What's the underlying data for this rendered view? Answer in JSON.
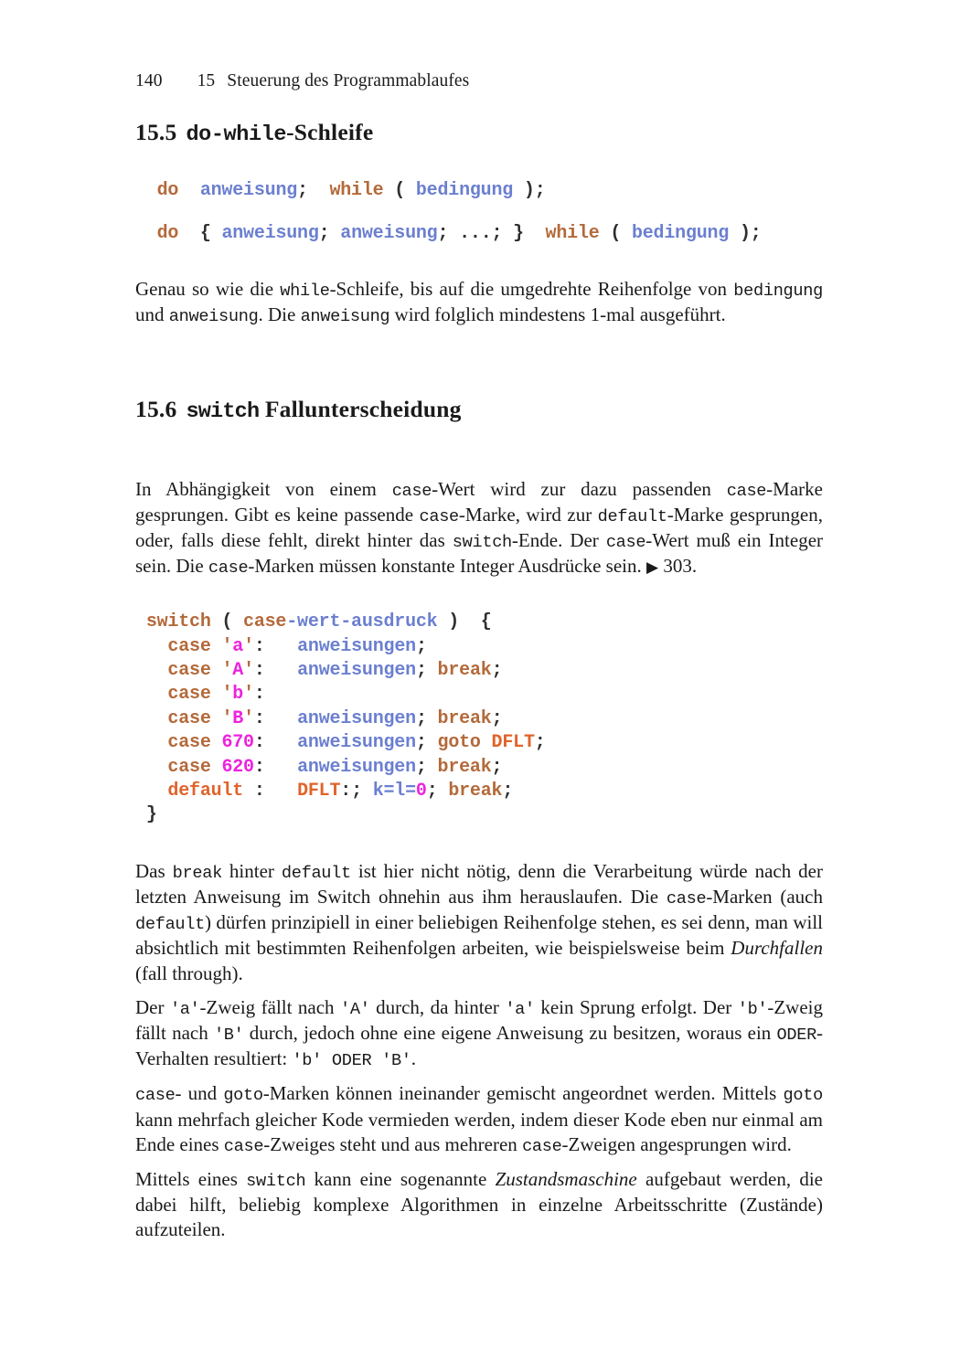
{
  "runhead": {
    "page_number": "140",
    "chapter_number": "15",
    "chapter_title": "Steuerung des Programmablaufes"
  },
  "sections": [
    {
      "number": "15.5",
      "title_mono": "do-while",
      "title_rest": "-Schleife"
    },
    {
      "number": "15.6",
      "title_mono": "switch",
      "title_rest": "Fallunterscheidung"
    }
  ],
  "code_dowhile": {
    "line1": {
      "t1": "do",
      "t2": "  ",
      "t3": "anweisung",
      "t4": ";  ",
      "t5": "while",
      "t6": " ( ",
      "t7": "bedingung",
      "t8": " );"
    },
    "line2": {
      "t1": "do",
      "t2": "  { ",
      "t3": "anweisung",
      "t4": "; ",
      "t5": "anweisung",
      "t6": "; ...; }  ",
      "t7": "while",
      "t8": " ( ",
      "t9": "bedingung",
      "t10": " );"
    }
  },
  "para_dowhile": {
    "s1": "Genau so wie die ",
    "m1": "while",
    "s2": "-Schleife, bis auf die umgedrehte Reihenfolge von ",
    "m2": "bedingung",
    "s3": " und ",
    "m3": "anweisung",
    "s4": ". Die ",
    "m4": "anweisung",
    "s5": " wird folglich mindestens 1-mal ausgeführt."
  },
  "para_switch_intro": {
    "s1": "In Abhängigkeit von einem ",
    "m1": "case",
    "s2": "-Wert wird zur dazu passenden ",
    "m2": "case",
    "s3": "-Marke gesprungen. Gibt es keine passende ",
    "m3": "case",
    "s4": "-Marke, wird zur ",
    "m4": "default",
    "s5": "-Marke gesprungen, oder, falls diese fehlt, direkt hinter das ",
    "m5": "switch",
    "s6": "-Ende. Der ",
    "m6": "case",
    "s7": "-Wert muß ein Integer sein. Die ",
    "m7": "case",
    "s8": "-Marken müssen konstante Integer Ausdrücke sein. ",
    "xref_arrow": "▶",
    "xref_page": "303."
  },
  "code_switch": {
    "l1": {
      "kw": "switch",
      "p1": " ( ",
      "kw2": "case",
      "id": "-wert-ausdruck",
      "p2": " )  {"
    },
    "l2": {
      "indent": "  ",
      "kw": "case",
      "sp": " ",
      "q1": "'",
      "lit": "a",
      "q2": "'",
      "colon": ":   ",
      "id": "anweisungen",
      "end": ";"
    },
    "l3": {
      "indent": "  ",
      "kw": "case",
      "sp": " ",
      "q1": "'",
      "lit": "A",
      "q2": "'",
      "colon": ":   ",
      "id": "anweisungen",
      "semi": "; ",
      "kw2": "break",
      "end": ";"
    },
    "l4": {
      "indent": "  ",
      "kw": "case",
      "sp": " ",
      "q1": "'",
      "lit": "b",
      "q2": "'",
      "colon": ":"
    },
    "l5": {
      "indent": "  ",
      "kw": "case",
      "sp": " ",
      "q1": "'",
      "lit": "B",
      "q2": "'",
      "colon": ":   ",
      "id": "anweisungen",
      "semi": "; ",
      "kw2": "break",
      "end": ";"
    },
    "l6": {
      "indent": "  ",
      "kw": "case",
      "sp": " ",
      "lit": "670",
      "colon": ":   ",
      "id": "anweisungen",
      "semi": "; ",
      "kw2": "goto",
      "sp2": " ",
      "lbl": "DFLT",
      "end": ";"
    },
    "l7": {
      "indent": "  ",
      "kw": "case",
      "sp": " ",
      "lit": "620",
      "colon": ":   ",
      "id": "anweisungen",
      "semi": "; ",
      "kw2": "break",
      "end": ";"
    },
    "l8": {
      "indent": "  ",
      "kw": "default",
      "colon": " :   ",
      "lbl": "DFLT",
      "semi": ":; ",
      "id": "k=l=",
      "lit": "0",
      "semi2": "; ",
      "kw2": "break",
      "end": ";"
    },
    "l9": {
      "brace": "}"
    }
  },
  "para_break": {
    "s1": "Das ",
    "m1": "break",
    "s2": " hinter ",
    "m2": "default",
    "s3": " ist hier nicht nötig, denn die Verarbeitung würde nach der letzten Anweisung im Switch ohnehin aus ihm herauslaufen. Die ",
    "m3": "case",
    "s4": "-Marken (auch ",
    "m4": "default",
    "s5": ") dürfen prinzipiell in einer beliebigen Reihenfolge stehen, es sei denn, man will absichtlich mit bestimmten Reihenfolgen arbeiten, wie beispielsweise beim ",
    "i1": "Durchfallen",
    "s6": " (fall through)."
  },
  "para_fallthrough": {
    "s1": "Der ",
    "m1": "'a'",
    "s2": "-Zweig fällt nach ",
    "m2": "'A'",
    "s3": " durch, da hinter ",
    "m3": "'a'",
    "s4": " kein Sprung erfolgt. Der ",
    "m4": "'b'",
    "s5": "-Zweig fällt nach ",
    "m5": "'B'",
    "s6": " durch, jedoch ohne eine eigene Anweisung zu besitzen, woraus ein ",
    "m6": "ODER",
    "s7": "-Verhalten resultiert: ",
    "m7": "'b' ODER 'B'",
    "s8": "."
  },
  "para_goto": {
    "m1": "case",
    "s1": "- und ",
    "m2": "goto",
    "s2": "-Marken können ineinander gemischt angeordnet werden. Mittels ",
    "m3": "goto",
    "s3": " kann mehrfach gleicher Kode vermieden werden, indem dieser Kode eben nur einmal am Ende eines ",
    "m4": "case",
    "s4": "-Zweiges steht und aus mehreren ",
    "m5": "case",
    "s5": "-Zweigen angesprungen wird."
  },
  "para_statemachine": {
    "s1": "Mittels eines ",
    "m1": "switch",
    "s2": " kann eine sogenannte ",
    "i1": "Zustandsmaschine",
    "s3": " aufgebaut werden, die dabei hilft, beliebig komplexe Algorithmen in einzelne Arbeitsschritte (Zustände) aufzuteilen."
  }
}
